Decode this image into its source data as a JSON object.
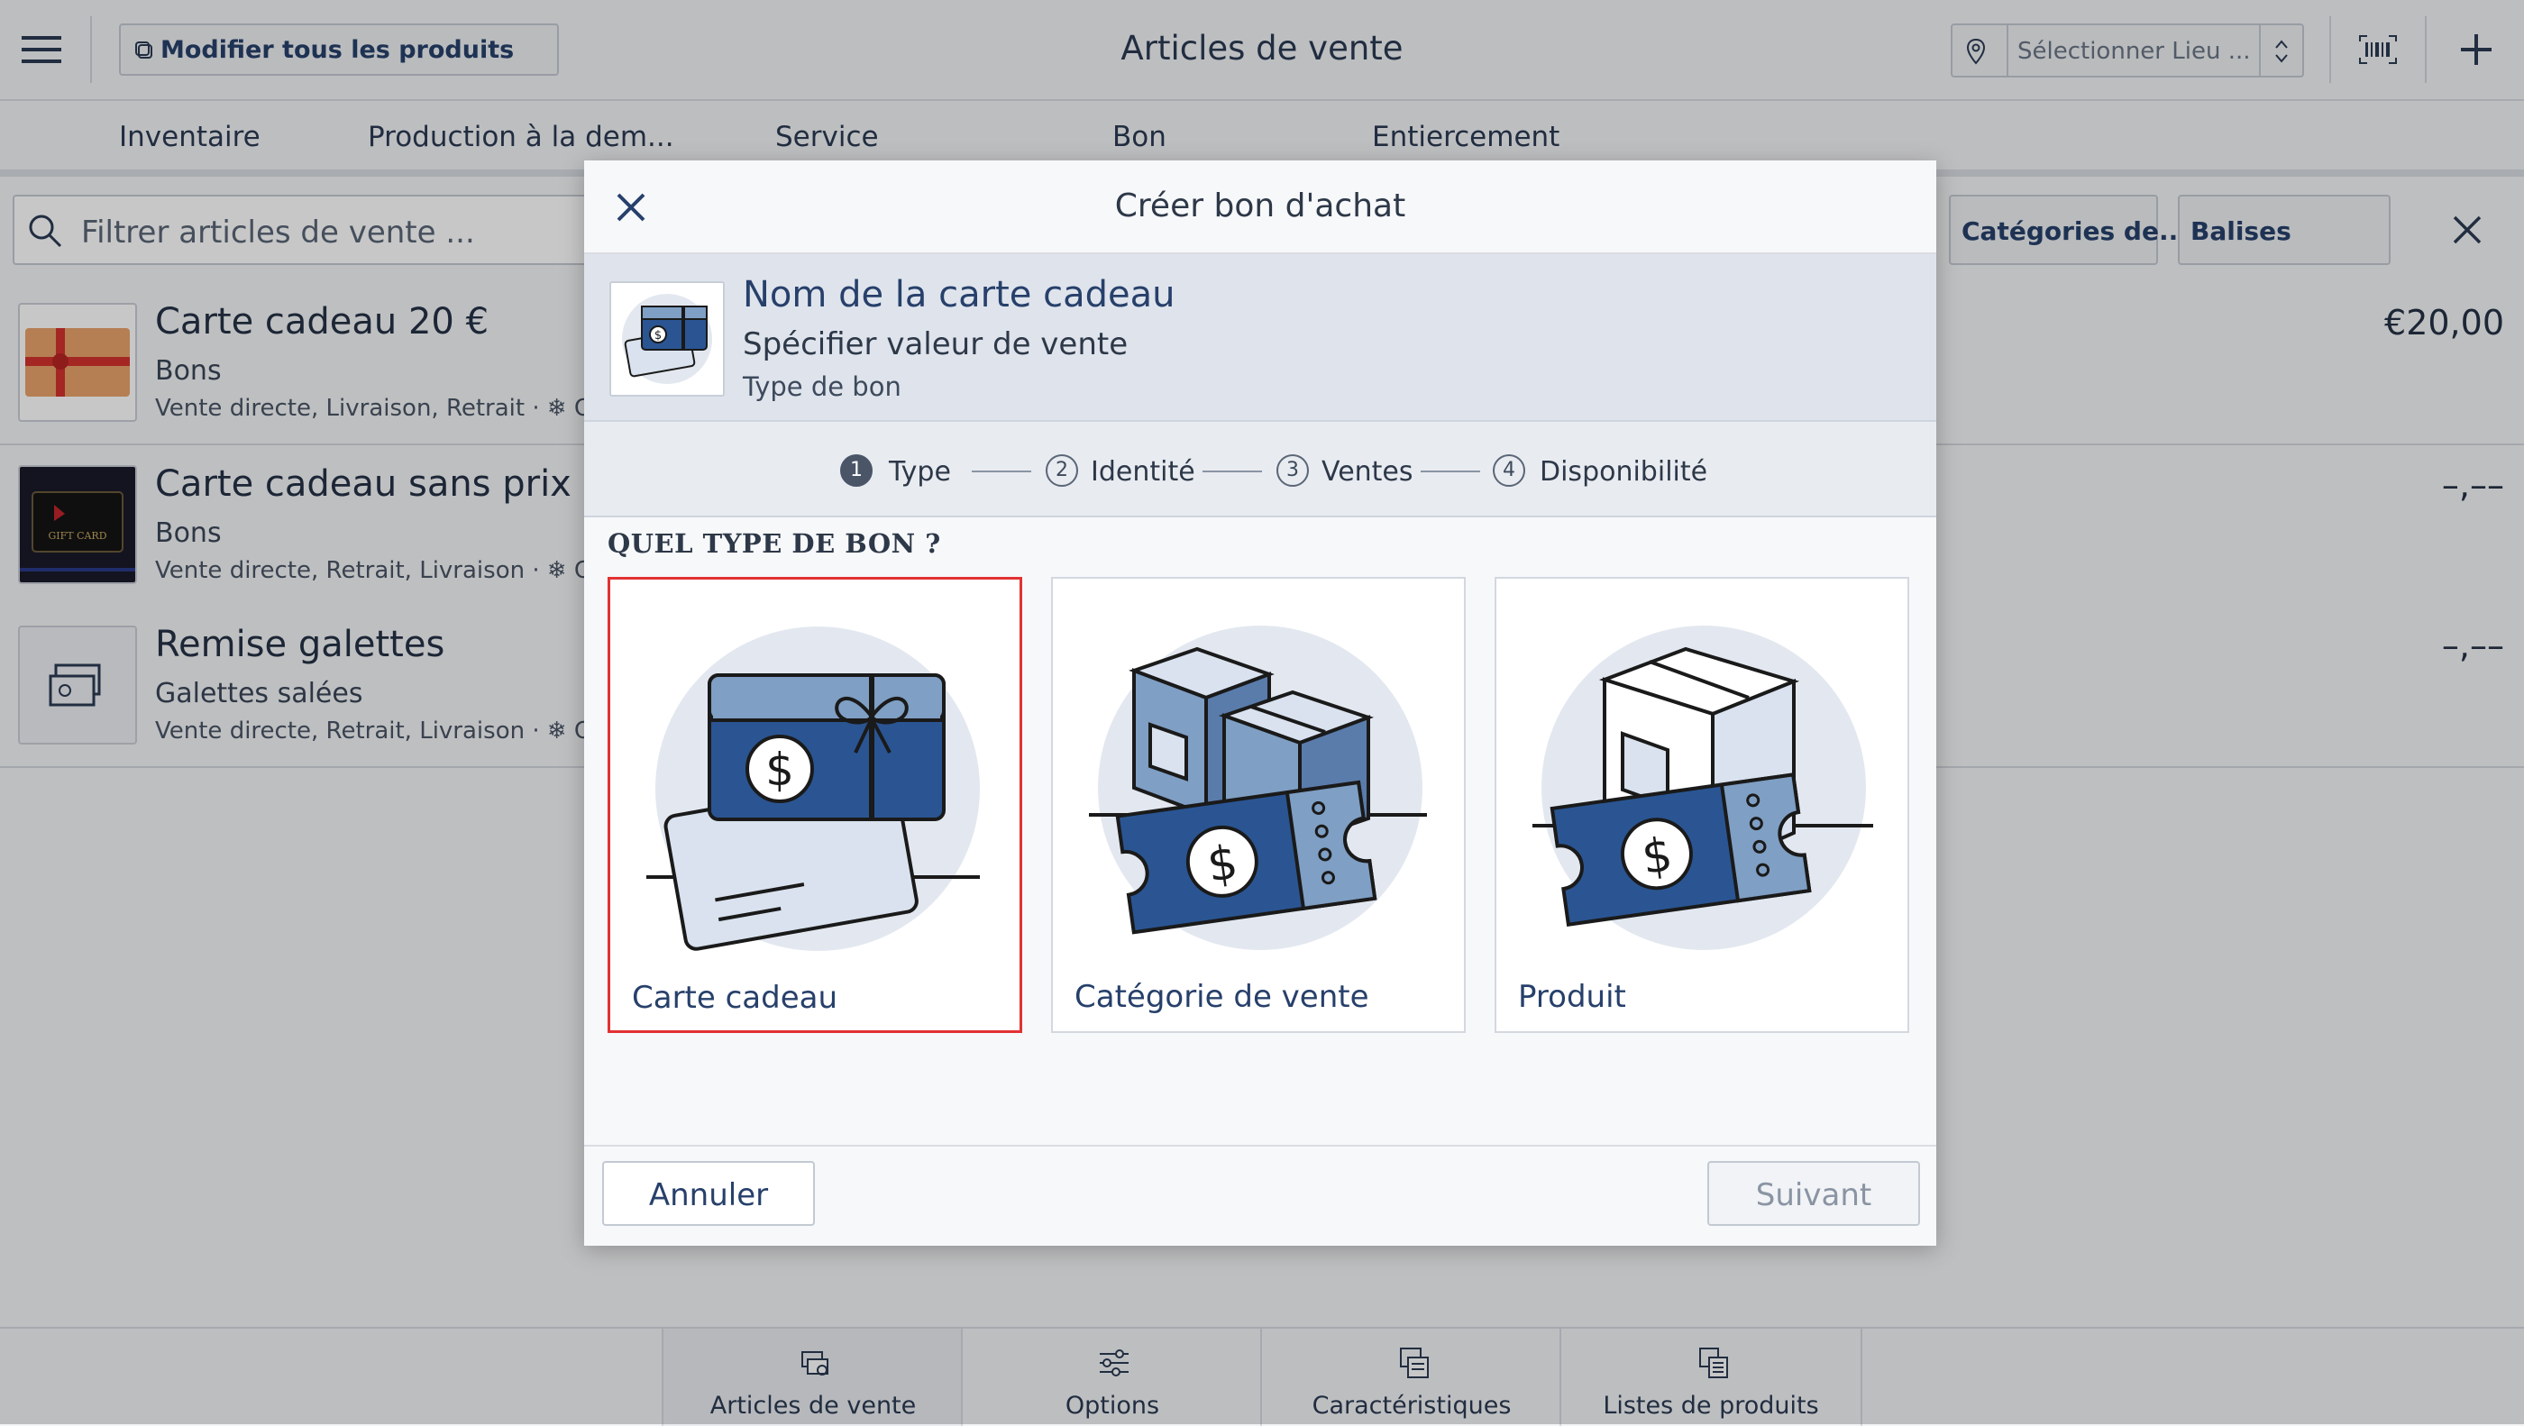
{
  "header": {
    "menu_icon": "hamburger-icon",
    "edit_all_label": "Modifier tous les produits",
    "title": "Articles de vente",
    "location_placeholder": "Sélectionner Lieu ......",
    "barcode_icon": "barcode-icon",
    "add_icon": "plus-icon"
  },
  "tabs": [
    "Inventaire",
    "Production à la dem...",
    "Service",
    "Bon",
    "Entiercement"
  ],
  "filter": {
    "placeholder": "Filtrer articles de vente ...",
    "categories_label": "Catégories de...",
    "tags_label": "Balises"
  },
  "list": [
    {
      "title": "Carte cadeau 20 €",
      "subtitle": "Bons",
      "tags": "Vente directe, Livraison, Retrait · ❄ Cr",
      "price": "€20,00"
    },
    {
      "title": "Carte cadeau sans prix",
      "subtitle": "Bons",
      "tags": "Vente directe, Retrait, Livraison · ❄ Cr",
      "price": "–,––"
    },
    {
      "title": "Remise galettes",
      "subtitle": "Galettes salées",
      "tags": "Vente directe, Retrait, Livraison · ❄ Cr",
      "price": "–,––"
    }
  ],
  "bottom_nav": [
    "Articles de vente",
    "Options",
    "Caractéristiques",
    "Listes de produits"
  ],
  "modal": {
    "title": "Créer bon d'achat",
    "info": {
      "name": "Nom de la carte cadeau",
      "subtitle": "Spécifier valeur de vente",
      "type": "Type de bon"
    },
    "steps": [
      {
        "num": "1",
        "label": "Type"
      },
      {
        "num": "2",
        "label": "Identité"
      },
      {
        "num": "3",
        "label": "Ventes"
      },
      {
        "num": "4",
        "label": "Disponibilité"
      }
    ],
    "question": "QUEL TYPE DE BON ?",
    "options": [
      {
        "label": "Carte cadeau",
        "selected": true
      },
      {
        "label": "Catégorie de vente",
        "selected": false
      },
      {
        "label": "Produit",
        "selected": false
      }
    ],
    "cancel_label": "Annuler",
    "next_label": "Suivant"
  },
  "colors": {
    "accent": "#27406b",
    "selection": "#e23232",
    "illustration_dark": "#2a5592",
    "illustration_light": "#7f9fc4"
  }
}
